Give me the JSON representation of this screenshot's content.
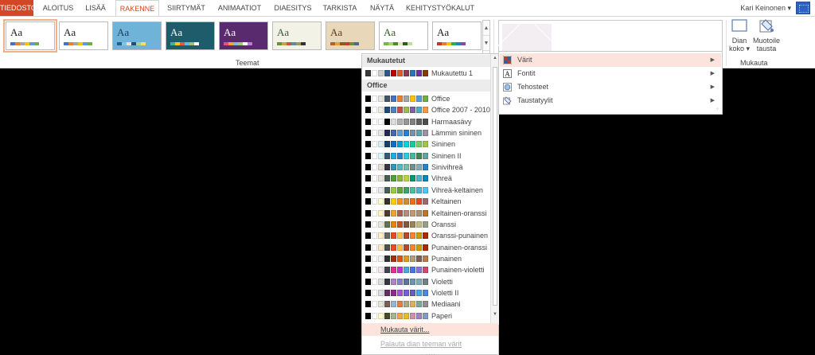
{
  "tabs": [
    {
      "label": "TIEDOSTO",
      "state": "file"
    },
    {
      "label": "ALOITUS",
      "state": ""
    },
    {
      "label": "LISÄÄ",
      "state": ""
    },
    {
      "label": "RAKENNE",
      "state": "active"
    },
    {
      "label": "SIIRTYMÄT",
      "state": ""
    },
    {
      "label": "ANIMAATIOT",
      "state": ""
    },
    {
      "label": "DIAESITYS",
      "state": ""
    },
    {
      "label": "TARKISTA",
      "state": ""
    },
    {
      "label": "NÄYTÄ",
      "state": ""
    },
    {
      "label": "KEHITYSTYÖKALUT",
      "state": ""
    }
  ],
  "user": {
    "name": "Kari Keinonen",
    "caret": "▾"
  },
  "ribbon": {
    "themes_group_label": "Teemat",
    "customize_group_label": "Mukauta",
    "theme_thumb_text": "Aa",
    "slide_size_label": "Dian koko ▾",
    "format_bg_label": "Muotoile tausta",
    "scroll_up": "▲",
    "scroll_down": "▼",
    "scroll_more": "▾"
  },
  "themes": [
    {
      "bg": "#ffffff",
      "fg": "#222222",
      "bar": [
        "#4472c4",
        "#ed7d31",
        "#a5a5a5",
        "#ffc000",
        "#5b9bd5",
        "#70ad47"
      ],
      "selected": true
    },
    {
      "bg": "#ffffff",
      "fg": "#222222",
      "bar": [
        "#4472c4",
        "#ed7d31",
        "#a5a5a5",
        "#ffc000",
        "#5b9bd5",
        "#70ad47"
      ],
      "selected": false
    },
    {
      "bg": "#6fb4d8",
      "fg": "#1d3c57",
      "bar": [
        "#2b5f8a",
        "#7ec6e0",
        "#e3e3e3",
        "#1f4e79",
        "#a9d18e",
        "#ffd966"
      ],
      "selected": false
    },
    {
      "bg": "#1f5c6b",
      "fg": "#ffffff",
      "bar": [
        "#3fb3a1",
        "#f0c929",
        "#e05a47",
        "#6bb5d8",
        "#9ec16a",
        "#ffffff"
      ],
      "selected": false
    },
    {
      "bg": "#5a2a6e",
      "fg": "#ffffff",
      "bar": [
        "#e84a8b",
        "#f3a23c",
        "#7fbbde",
        "#9ad06a",
        "#ffffff",
        "#c07ad6"
      ],
      "selected": false
    },
    {
      "bg": "#f2f2e6",
      "fg": "#3c5a3c",
      "bar": [
        "#6a8f3d",
        "#c5a63b",
        "#b85c3a",
        "#5d8aa8",
        "#9c9c5e",
        "#333333"
      ],
      "selected": false
    },
    {
      "bg": "#e8d7b8",
      "fg": "#5a3b1b",
      "bar": [
        "#b5651d",
        "#d9a441",
        "#8a5a2b",
        "#c63d2f",
        "#6e8b3d",
        "#4a6d8c"
      ],
      "selected": false
    },
    {
      "bg": "#ffffff",
      "fg": "#2e5e1f",
      "bar": [
        "#74b843",
        "#a3d36b",
        "#4c8a2b",
        "#dfe7c7",
        "#2e5e1f",
        "#c3d99f"
      ],
      "selected": false
    },
    {
      "bg": "#ffffff",
      "fg": "#222222",
      "bar": [
        "#c0392b",
        "#e67e22",
        "#f1c40f",
        "#27ae60",
        "#2980b9",
        "#8e44ad"
      ],
      "selected": false
    }
  ],
  "palette_menu": {
    "custom_header": "Mukautetut",
    "office_header": "Office",
    "customize_colors": "Mukauta värit...",
    "reset_colors": "Palauta dian teeman värit",
    "grip": "....",
    "custom": [
      {
        "name": "Mukautettu 1",
        "colors": [
          "#3a3a3a",
          "#ffffff",
          "#cfcfcf",
          "#2f5597",
          "#c00000",
          "#e05a2b",
          "#8e3a59",
          "#2e75b6",
          "#7030a0",
          "#843c0c"
        ]
      }
    ],
    "office": [
      {
        "name": "Office",
        "colors": [
          "#000000",
          "#ffffff",
          "#e7e6e6",
          "#44546a",
          "#4472c4",
          "#ed7d31",
          "#a5a5a5",
          "#ffc000",
          "#5b9bd5",
          "#70ad47"
        ]
      },
      {
        "name": "Office 2007 - 2010",
        "colors": [
          "#000000",
          "#ffffff",
          "#eeece1",
          "#1f497d",
          "#4f81bd",
          "#c0504d",
          "#9bbb59",
          "#8064a2",
          "#4bacc6",
          "#f79646"
        ]
      },
      {
        "name": "Harmaasävy",
        "colors": [
          "#000000",
          "#ffffff",
          "#f8f8f8",
          "#000000",
          "#dddddd",
          "#b2b2b2",
          "#969696",
          "#808080",
          "#5f5f5f",
          "#4d4d4d"
        ]
      },
      {
        "name": "Lämmin sininen",
        "colors": [
          "#000000",
          "#ffffff",
          "#e7e6e6",
          "#242852",
          "#4a66ac",
          "#629dd1",
          "#297fd5",
          "#7f8fa9",
          "#5aa2ae",
          "#9d90a0"
        ]
      },
      {
        "name": "Sininen",
        "colors": [
          "#000000",
          "#ffffff",
          "#dbeef4",
          "#17406d",
          "#0f6fc6",
          "#009dd9",
          "#0bd0d9",
          "#10cf9b",
          "#7cca62",
          "#a5c249"
        ]
      },
      {
        "name": "Sininen II",
        "colors": [
          "#000000",
          "#ffffff",
          "#dbf5f9",
          "#335b74",
          "#1cade4",
          "#2683c6",
          "#27ced7",
          "#42ba97",
          "#3e8853",
          "#62a39f"
        ]
      },
      {
        "name": "Sinivihreä",
        "colors": [
          "#000000",
          "#ffffff",
          "#e3ded1",
          "#373545",
          "#3494ba",
          "#58b6c0",
          "#75bda7",
          "#7a8c8e",
          "#84acb6",
          "#2683c6"
        ]
      },
      {
        "name": "Vihreä",
        "colors": [
          "#000000",
          "#ffffff",
          "#e9e5dc",
          "#455f51",
          "#549e39",
          "#8ab833",
          "#c0cf3a",
          "#029676",
          "#4ab5c4",
          "#0989b1"
        ]
      },
      {
        "name": "Vihreä-keltainen",
        "colors": [
          "#000000",
          "#ffffff",
          "#e8e8e8",
          "#455f51",
          "#99cb38",
          "#63a537",
          "#37a76f",
          "#44c1a3",
          "#4eb3cf",
          "#51c3f9"
        ]
      },
      {
        "name": "Keltainen",
        "colors": [
          "#000000",
          "#ffffff",
          "#fefbd1",
          "#39302a",
          "#ffca08",
          "#f8931d",
          "#ce8d3e",
          "#ec7016",
          "#e64823",
          "#9c6a6a"
        ]
      },
      {
        "name": "Keltainen-oranssi",
        "colors": [
          "#000000",
          "#ffffff",
          "#fff1c1",
          "#4e3b30",
          "#f0a22e",
          "#a5644e",
          "#b58b80",
          "#c3986d",
          "#a19574",
          "#c17529"
        ]
      },
      {
        "name": "Oranssi",
        "colors": [
          "#000000",
          "#ffffff",
          "#e8e7dd",
          "#637052",
          "#e48312",
          "#bd582c",
          "#865640",
          "#9b8357",
          "#c2bc80",
          "#94a088"
        ]
      },
      {
        "name": "Oranssi-punainen",
        "colors": [
          "#000000",
          "#ffffff",
          "#fbeec9",
          "#696464",
          "#e84c22",
          "#ffbd47",
          "#b64926",
          "#ff8427",
          "#cc9900",
          "#b22600"
        ]
      },
      {
        "name": "Punainen-oranssi",
        "colors": [
          "#000000",
          "#ffffff",
          "#fbe7c8",
          "#505046",
          "#e84c22",
          "#ffbd47",
          "#b64926",
          "#ff8427",
          "#cc9900",
          "#b22600"
        ]
      },
      {
        "name": "Punainen",
        "colors": [
          "#000000",
          "#ffffff",
          "#f2f2f2",
          "#323232",
          "#a5300f",
          "#d55816",
          "#e19825",
          "#b19c7d",
          "#7f5f52",
          "#b27d49"
        ]
      },
      {
        "name": "Punainen-violetti",
        "colors": [
          "#000000",
          "#ffffff",
          "#f3e8ef",
          "#454551",
          "#e32d91",
          "#c830cc",
          "#4ea6dc",
          "#4775e7",
          "#8971e1",
          "#d54773"
        ]
      },
      {
        "name": "Violetti",
        "colors": [
          "#000000",
          "#ffffff",
          "#dedede",
          "#373545",
          "#ad84c6",
          "#8784c7",
          "#5d739a",
          "#6997af",
          "#84acb6",
          "#6f8183"
        ]
      },
      {
        "name": "Violetti II",
        "colors": [
          "#000000",
          "#ffffff",
          "#dddde4",
          "#632e62",
          "#92278f",
          "#9b57d3",
          "#755dd9",
          "#665eb8",
          "#45a5ed",
          "#5982db"
        ]
      },
      {
        "name": "Mediaani",
        "colors": [
          "#000000",
          "#ffffff",
          "#e8e3d9",
          "#775f55",
          "#94b6d2",
          "#dd8047",
          "#a5ab81",
          "#d8b25c",
          "#7ba79d",
          "#968c8c"
        ]
      },
      {
        "name": "Paperi",
        "colors": [
          "#000000",
          "#ffffff",
          "#fefac9",
          "#444d26",
          "#a5b592",
          "#f3a447",
          "#e7bc29",
          "#d092a7",
          "#9c85c0",
          "#809ec2"
        ]
      }
    ]
  },
  "variant_menu": {
    "items": [
      {
        "label": "Värit",
        "icon": "colors-icon",
        "highlighted": true,
        "arrow": "▶"
      },
      {
        "label": "Fontit",
        "icon": "fonts-icon",
        "highlighted": false,
        "arrow": "▶"
      },
      {
        "label": "Tehosteet",
        "icon": "effects-icon",
        "highlighted": false,
        "arrow": "▶"
      },
      {
        "label": "Taustatyylit",
        "icon": "background-styles-icon",
        "highlighted": false,
        "arrow": "▶"
      }
    ],
    "grip": "⁘"
  }
}
